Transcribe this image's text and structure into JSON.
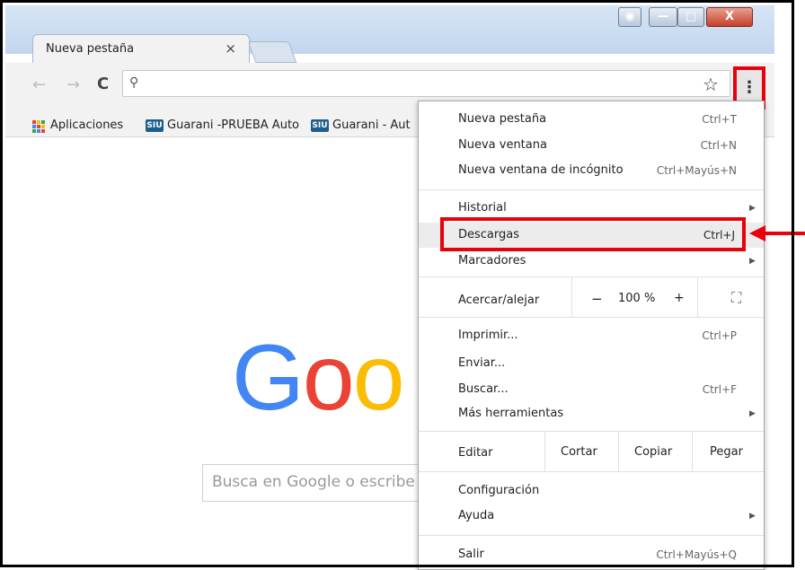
{
  "window": {
    "minimize_label": "—",
    "maximize_label": "□",
    "close_label": "X"
  },
  "tab": {
    "title": "Nueva pestaña",
    "close": "×"
  },
  "toolbar": {
    "back": "←",
    "forward": "→",
    "reload": "C",
    "search_glyph": "⚲",
    "star": "☆",
    "menu_glyph": "⋮"
  },
  "bookmarks": [
    {
      "label": "Aplicaciones"
    },
    {
      "label": "Guarani -PRUEBA Auto",
      "icon_text": "SIU"
    },
    {
      "label": "Guarani - Aut",
      "icon_text": "SIU"
    }
  ],
  "page": {
    "logo": [
      {
        "ch": "G",
        "color": "#4285F4"
      },
      {
        "ch": "o",
        "color": "#EA4335"
      },
      {
        "ch": "o",
        "color": "#FBBC05"
      }
    ],
    "search_placeholder": "Busca en Google o escribe"
  },
  "menu": {
    "new_tab": {
      "label": "Nueva pestaña",
      "shortcut": "Ctrl+T"
    },
    "new_window": {
      "label": "Nueva ventana",
      "shortcut": "Ctrl+N"
    },
    "incognito": {
      "label": "Nueva ventana de incógnito",
      "shortcut": "Ctrl+Mayús+N"
    },
    "history": {
      "label": "Historial"
    },
    "downloads": {
      "label": "Descargas",
      "shortcut": "Ctrl+J"
    },
    "bookmarks": {
      "label": "Marcadores"
    },
    "zoom": {
      "label": "Acercar/alejar",
      "minus": "−",
      "value": "100 %",
      "plus": "+",
      "fullscreen": "⛶"
    },
    "print": {
      "label": "Imprimir...",
      "shortcut": "Ctrl+P"
    },
    "cast": {
      "label": "Enviar..."
    },
    "find": {
      "label": "Buscar...",
      "shortcut": "Ctrl+F"
    },
    "more_tools": {
      "label": "Más herramientas"
    },
    "edit": {
      "label": "Editar",
      "cut": "Cortar",
      "copy": "Copiar",
      "paste": "Pegar"
    },
    "settings": {
      "label": "Configuración"
    },
    "help": {
      "label": "Ayuda"
    },
    "exit": {
      "label": "Salir",
      "shortcut": "Ctrl+Mayús+Q"
    },
    "submenu_arrow": "▶"
  },
  "colors": {
    "highlight_red": "#e8000b",
    "menu_hover": "#ececec"
  }
}
